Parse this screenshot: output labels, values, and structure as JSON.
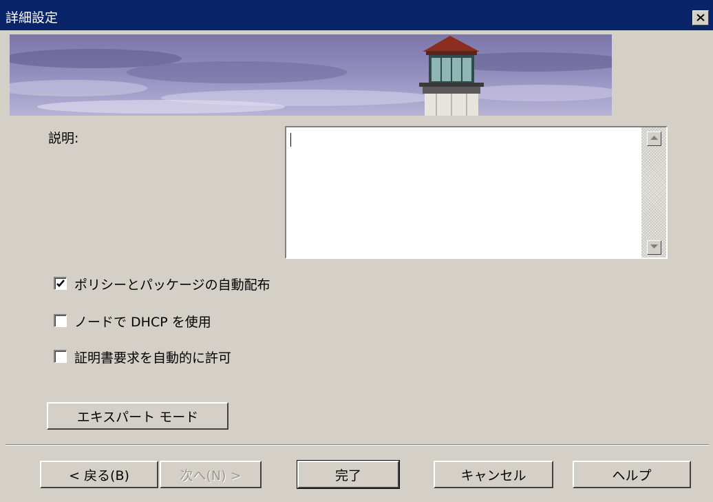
{
  "window": {
    "title": "詳細設定",
    "close_icon": "close-icon"
  },
  "banner": {
    "image": "lighthouse-banner"
  },
  "description": {
    "label": "説明:",
    "value": ""
  },
  "options": [
    {
      "label": "ポリシーとパッケージの自動配布",
      "checked": true
    },
    {
      "label": "ノードで DHCP を使用",
      "checked": false
    },
    {
      "label": "証明書要求を自動的に許可",
      "checked": false
    }
  ],
  "expert_mode_button": "エキスパート モード",
  "footer": {
    "back": "< 戻る(B)",
    "next": "次へ(N) >",
    "finish": "完了",
    "cancel": "キャンセル",
    "help": "ヘルプ"
  },
  "colors": {
    "titlebar": "#0a246a",
    "face": "#d4d0c8"
  }
}
